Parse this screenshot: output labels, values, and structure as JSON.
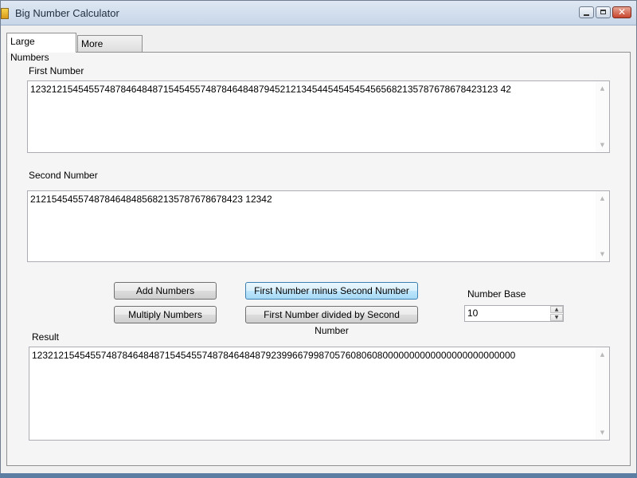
{
  "window": {
    "title": "Big Number Calculator"
  },
  "tabs": [
    {
      "label": "Large Numbers",
      "active": true
    },
    {
      "label": "More Software",
      "active": false
    }
  ],
  "first_number": {
    "label": "First Number",
    "value": "1232121545455748784648487154545574878464848794521213454454545454565682135787678678423123 42"
  },
  "second_number": {
    "label": "Second Number",
    "value": "2121545455748784648485682135787678678423 12342"
  },
  "buttons": {
    "add": "Add Numbers",
    "multiply": "Multiply Numbers",
    "subtract": "First Number minus Second Number",
    "divide": "First Number divided by Second Number"
  },
  "number_base": {
    "label": "Number Base",
    "value": "10"
  },
  "result": {
    "label": "Result",
    "value": "1232121545455748784648487154545574878464848792399667998705760806080000000000000000000000000"
  }
}
